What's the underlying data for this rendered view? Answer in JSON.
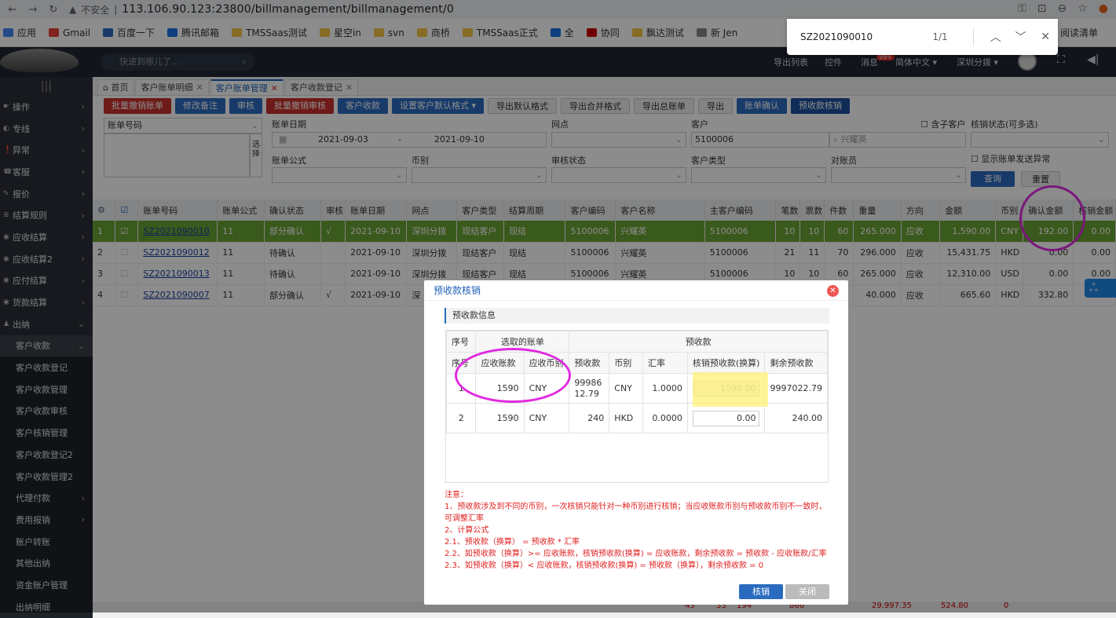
{
  "browser": {
    "insecure": "不安全",
    "url": "113.106.90.123:23800/billmanagement/billmanagement/0",
    "bookmarks": [
      "应用",
      "Gmail",
      "百度一下",
      "腾讯邮箱",
      "TMSSaas测试",
      "星空in",
      "svn",
      "商桥",
      "TMSSaas正式",
      "全",
      "协同",
      "飘达测试",
      "新 Jen",
      "阅读清单"
    ],
    "find": {
      "query": "SZ2021090010",
      "count": "1/1"
    }
  },
  "topbar": {
    "search_placeholder": "快速到哪儿了...",
    "menu": [
      "导出列表",
      "控件",
      "消息",
      "简体中文 ▾",
      "深圳分拨 ▾"
    ],
    "badge": "99+"
  },
  "sidebar": {
    "items": [
      {
        "label": "操作",
        "arrow": "›"
      },
      {
        "label": "专线",
        "arrow": "›"
      },
      {
        "label": "异常",
        "arrow": "›"
      },
      {
        "label": "客服",
        "arrow": "›"
      },
      {
        "label": "报价",
        "arrow": "›"
      },
      {
        "label": "结算规则",
        "arrow": "›"
      },
      {
        "label": "应收结算",
        "arrow": "›"
      },
      {
        "label": "应收结算2",
        "arrow": "›"
      },
      {
        "label": "应付结算",
        "arrow": "›"
      },
      {
        "label": "货款结算",
        "arrow": "›"
      },
      {
        "label": "出纳",
        "arrow": "⌄"
      }
    ],
    "sub_items": [
      "客户收款",
      "客户收款登记",
      "客户收款管理",
      "客户收款审核",
      "客户核销管理",
      "客户收款登记2",
      "客户收款管理2",
      "代理付款",
      "费用报销",
      "账户转账",
      "其他出纳",
      "资金账户管理",
      "出纳明细"
    ]
  },
  "tabs": [
    {
      "label": "首页",
      "closable": false
    },
    {
      "label": "客户账单明细",
      "closable": true
    },
    {
      "label": "客户账单管理",
      "closable": true,
      "active": true
    },
    {
      "label": "客户收款登记",
      "closable": true
    }
  ],
  "toolbar": [
    {
      "label": "批量撤销账单",
      "style": "red"
    },
    {
      "label": "修改备注",
      "style": "blue"
    },
    {
      "label": "审核",
      "style": "blue"
    },
    {
      "label": "批量撤销审核",
      "style": "red"
    },
    {
      "label": "客户收款",
      "style": "blue"
    },
    {
      "label": "设置客户默认格式 ▾",
      "style": "blue"
    },
    {
      "label": "导出默认格式",
      "style": "gray"
    },
    {
      "label": "导出合并格式",
      "style": "gray"
    },
    {
      "label": "导出总账单",
      "style": "gray"
    },
    {
      "label": "导出",
      "style": "gray"
    },
    {
      "label": "账单确认",
      "style": "blue"
    },
    {
      "label": "预收款核销",
      "style": "dark"
    }
  ],
  "filters": {
    "bill_no_label": "账单号码",
    "choose": "选择",
    "bill_date_label": "账单日期",
    "date_from": "2021-09-03",
    "date_sep": "-",
    "date_to": "2021-09-10",
    "outlet_label": "网点",
    "customer_label": "客户",
    "customer_code": "5100006",
    "customer_name": "兴耀英",
    "include_sub": "含子客户",
    "verify_status_label": "核销状态(可多选)",
    "formula_label": "账单公式",
    "currency_label": "币别",
    "review_label": "审核状态",
    "cust_type_label": "客户类型",
    "reconciler_label": "对账员",
    "show_abnormal": "显示账单发送异常",
    "query": "查询",
    "reset": "重置"
  },
  "grid": {
    "headers": [
      "",
      "",
      "账单号码",
      "账单公式",
      "确认状态",
      "审核",
      "账单日期",
      "网点",
      "客户类型",
      "结算周期",
      "客户编码",
      "客户名称",
      "主客户编码",
      "笔数",
      "票数",
      "件数",
      "重量",
      "方向",
      "金额",
      "币别",
      "确认金额",
      "核销金额"
    ],
    "rows": [
      {
        "n": "1",
        "no": "SZ2021090010",
        "formula": "11",
        "confirm": "部分确认",
        "audit": "√",
        "date": "2021-09-10",
        "outlet": "深圳分拨",
        "ctype": "现结客户",
        "cycle": "现结",
        "code": "5100006",
        "name": "兴耀英",
        "main": "5100006",
        "c1": "10",
        "c2": "10",
        "c3": "60",
        "w": "265.000",
        "dir": "应收",
        "amt": "1,590.00",
        "cur": "CNY",
        "camt": "192.00",
        "vamt": "0.00"
      },
      {
        "n": "2",
        "no": "SZ2021090012",
        "formula": "11",
        "confirm": "待确认",
        "audit": "",
        "date": "2021-09-10",
        "outlet": "深圳分拨",
        "ctype": "现结客户",
        "cycle": "现结",
        "code": "5100006",
        "name": "兴耀英",
        "main": "5100006",
        "c1": "21",
        "c2": "11",
        "c3": "70",
        "w": "296.000",
        "dir": "应收",
        "amt": "15,431.75",
        "cur": "HKD",
        "camt": "0.00",
        "vamt": "0.00"
      },
      {
        "n": "3",
        "no": "SZ2021090013",
        "formula": "11",
        "confirm": "待确认",
        "audit": "",
        "date": "2021-09-10",
        "outlet": "深圳分拨",
        "ctype": "现结客户",
        "cycle": "现结",
        "code": "5100006",
        "name": "兴耀英",
        "main": "5100006",
        "c1": "10",
        "c2": "10",
        "c3": "60",
        "w": "265.000",
        "dir": "应收",
        "amt": "12,310.00",
        "cur": "USD",
        "camt": "0.00",
        "vamt": "0.00"
      },
      {
        "n": "4",
        "no": "SZ2021090007",
        "formula": "11",
        "confirm": "部分确认",
        "audit": "√",
        "date": "2021-09-10",
        "outlet": "深",
        "ctype": "",
        "cycle": "",
        "code": "",
        "name": "",
        "main": "",
        "c1": "",
        "c2": "",
        "c3": "",
        "w": "40.000",
        "dir": "应收",
        "amt": "665.60",
        "cur": "HKD",
        "camt": "332.80",
        "vamt": "0.00"
      }
    ],
    "totals": [
      "43",
      "33",
      "194",
      "866",
      "29,997.35",
      "524.80",
      "0"
    ]
  },
  "modal": {
    "title": "预收款核销",
    "section": "预收款信息",
    "group_selected": "选取的账单",
    "group_prepay": "预收款",
    "headers": [
      "序号",
      "应收账款",
      "应收币别",
      "预收款",
      "币别",
      "汇率",
      "核销预收款(换算)",
      "剩余预收款"
    ],
    "seq_header": "序号",
    "rows": [
      {
        "n": "1",
        "ar": "1590",
        "arcur": "CNY",
        "pre": "9998612.79",
        "precur": "CNY",
        "rate": "1.0000",
        "verify": "1590.00",
        "remain": "9997022.79"
      },
      {
        "n": "2",
        "ar": "1590",
        "arcur": "CNY",
        "pre": "240",
        "precur": "HKD",
        "rate": "0.0000",
        "verify": "0.00",
        "remain": "240.00"
      }
    ],
    "notes": [
      "注意：",
      "1、预收款涉及到不同的币别，一次核销只能针对一种币别进行核销；当应收账款币别与预收款币别不一致时，可调整汇率",
      "2、计算公式",
      "2.1、预收款（换算） = 预收款 * 汇率",
      "2.2、如预收款（换算）>= 应收账款，核销预收款(换算) = 应收账款，剩余预收款 = 预收款 - 应收账款/汇率",
      "2.3、如预收款（换算）< 应收账款，核销预收款(换算) = 预收款（换算），剩余预收款 = 0"
    ],
    "ok": "核销",
    "close": "关闭"
  }
}
